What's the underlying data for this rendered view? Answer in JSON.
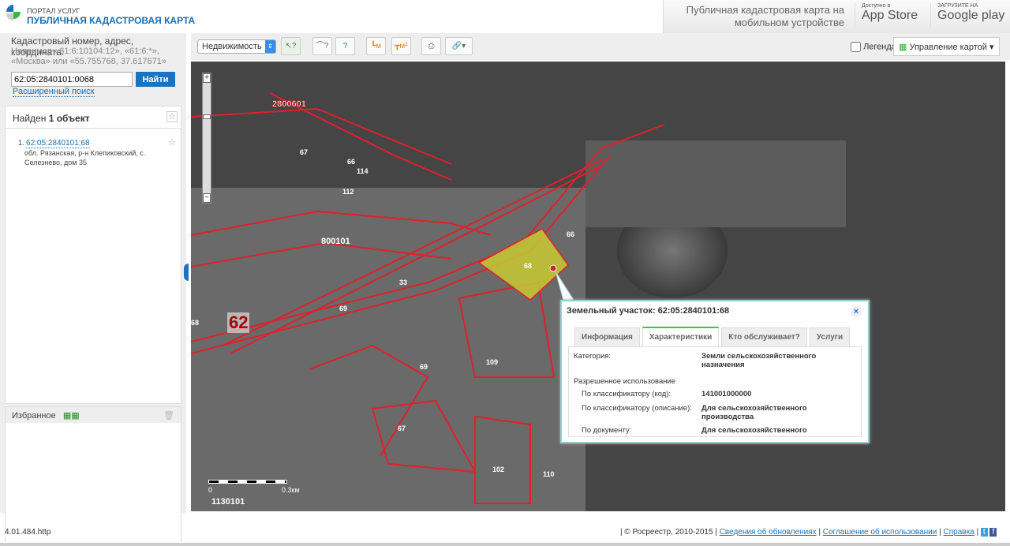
{
  "header": {
    "portal": "ПОРТАЛ УСЛУГ",
    "title": "ПУБЛИЧНАЯ КАДАСТРОВАЯ КАРТА",
    "mobile_text": "Публичная кадастровая карта на мобильном устройстве",
    "appstore_small": "Доступно в",
    "appstore": "App Store",
    "gplay_small": "ЗАГРУЗИТЕ НА",
    "gplay": "Google play"
  },
  "search": {
    "label": "Кадастровый номер, адрес, координата:",
    "hint": "Например «61:6:10104:12», «61:6:*», «Москва» или «55.755768, 37.617671»",
    "value": "62:05:2840101:0068",
    "button": "Найти",
    "advanced": "Расширенный поиск"
  },
  "results": {
    "found_prefix": "Найден ",
    "found_count": "1 объект",
    "items": [
      {
        "num": "1.",
        "id": "62:05:2840101:68",
        "address": "обл. Рязанская, р-н Клепиковский, с. Селезнево, дом 35"
      }
    ]
  },
  "favorites": {
    "label": "Избранное"
  },
  "toolbar": {
    "select": "Недвижимость",
    "legend": "Легенда",
    "map_control": "Управление картой"
  },
  "map": {
    "labels": [
      "2800601",
      "800101",
      "62",
      "1130101",
      "67",
      "66",
      "114",
      "112",
      "33",
      "69",
      "68",
      "109",
      "102",
      "110",
      "66",
      "69",
      "67",
      "68"
    ],
    "scale": [
      "0",
      "0.3км"
    ],
    "parcel_fill": "#c8c832",
    "boundary_color": "#e0202a"
  },
  "popup": {
    "title": "Земельный участок: 62:05:2840101:68",
    "tabs": [
      "Информация",
      "Характеристики",
      "Кто обслуживает?",
      "Услуги"
    ],
    "active_tab": "Характеристики",
    "category_label": "Категория:",
    "category_value": "Земли сельскохозяйственного назначения",
    "use_label": "Разрешенное использование",
    "code_label": "По классификатору (код):",
    "code_value": "141001000000",
    "desc_label": "По классификатору (описание):",
    "desc_value": "Для сельскохозяйственного производства",
    "doc_label": "По документу:",
    "doc_value": "Для сельскохозяйственного"
  },
  "footer": {
    "version": "4.01.484.http",
    "copyright": "| © Росреестр, 2010-2015 |",
    "links": [
      "Сведения об обновлениях",
      "Соглашение об использовании",
      "Справка"
    ]
  }
}
